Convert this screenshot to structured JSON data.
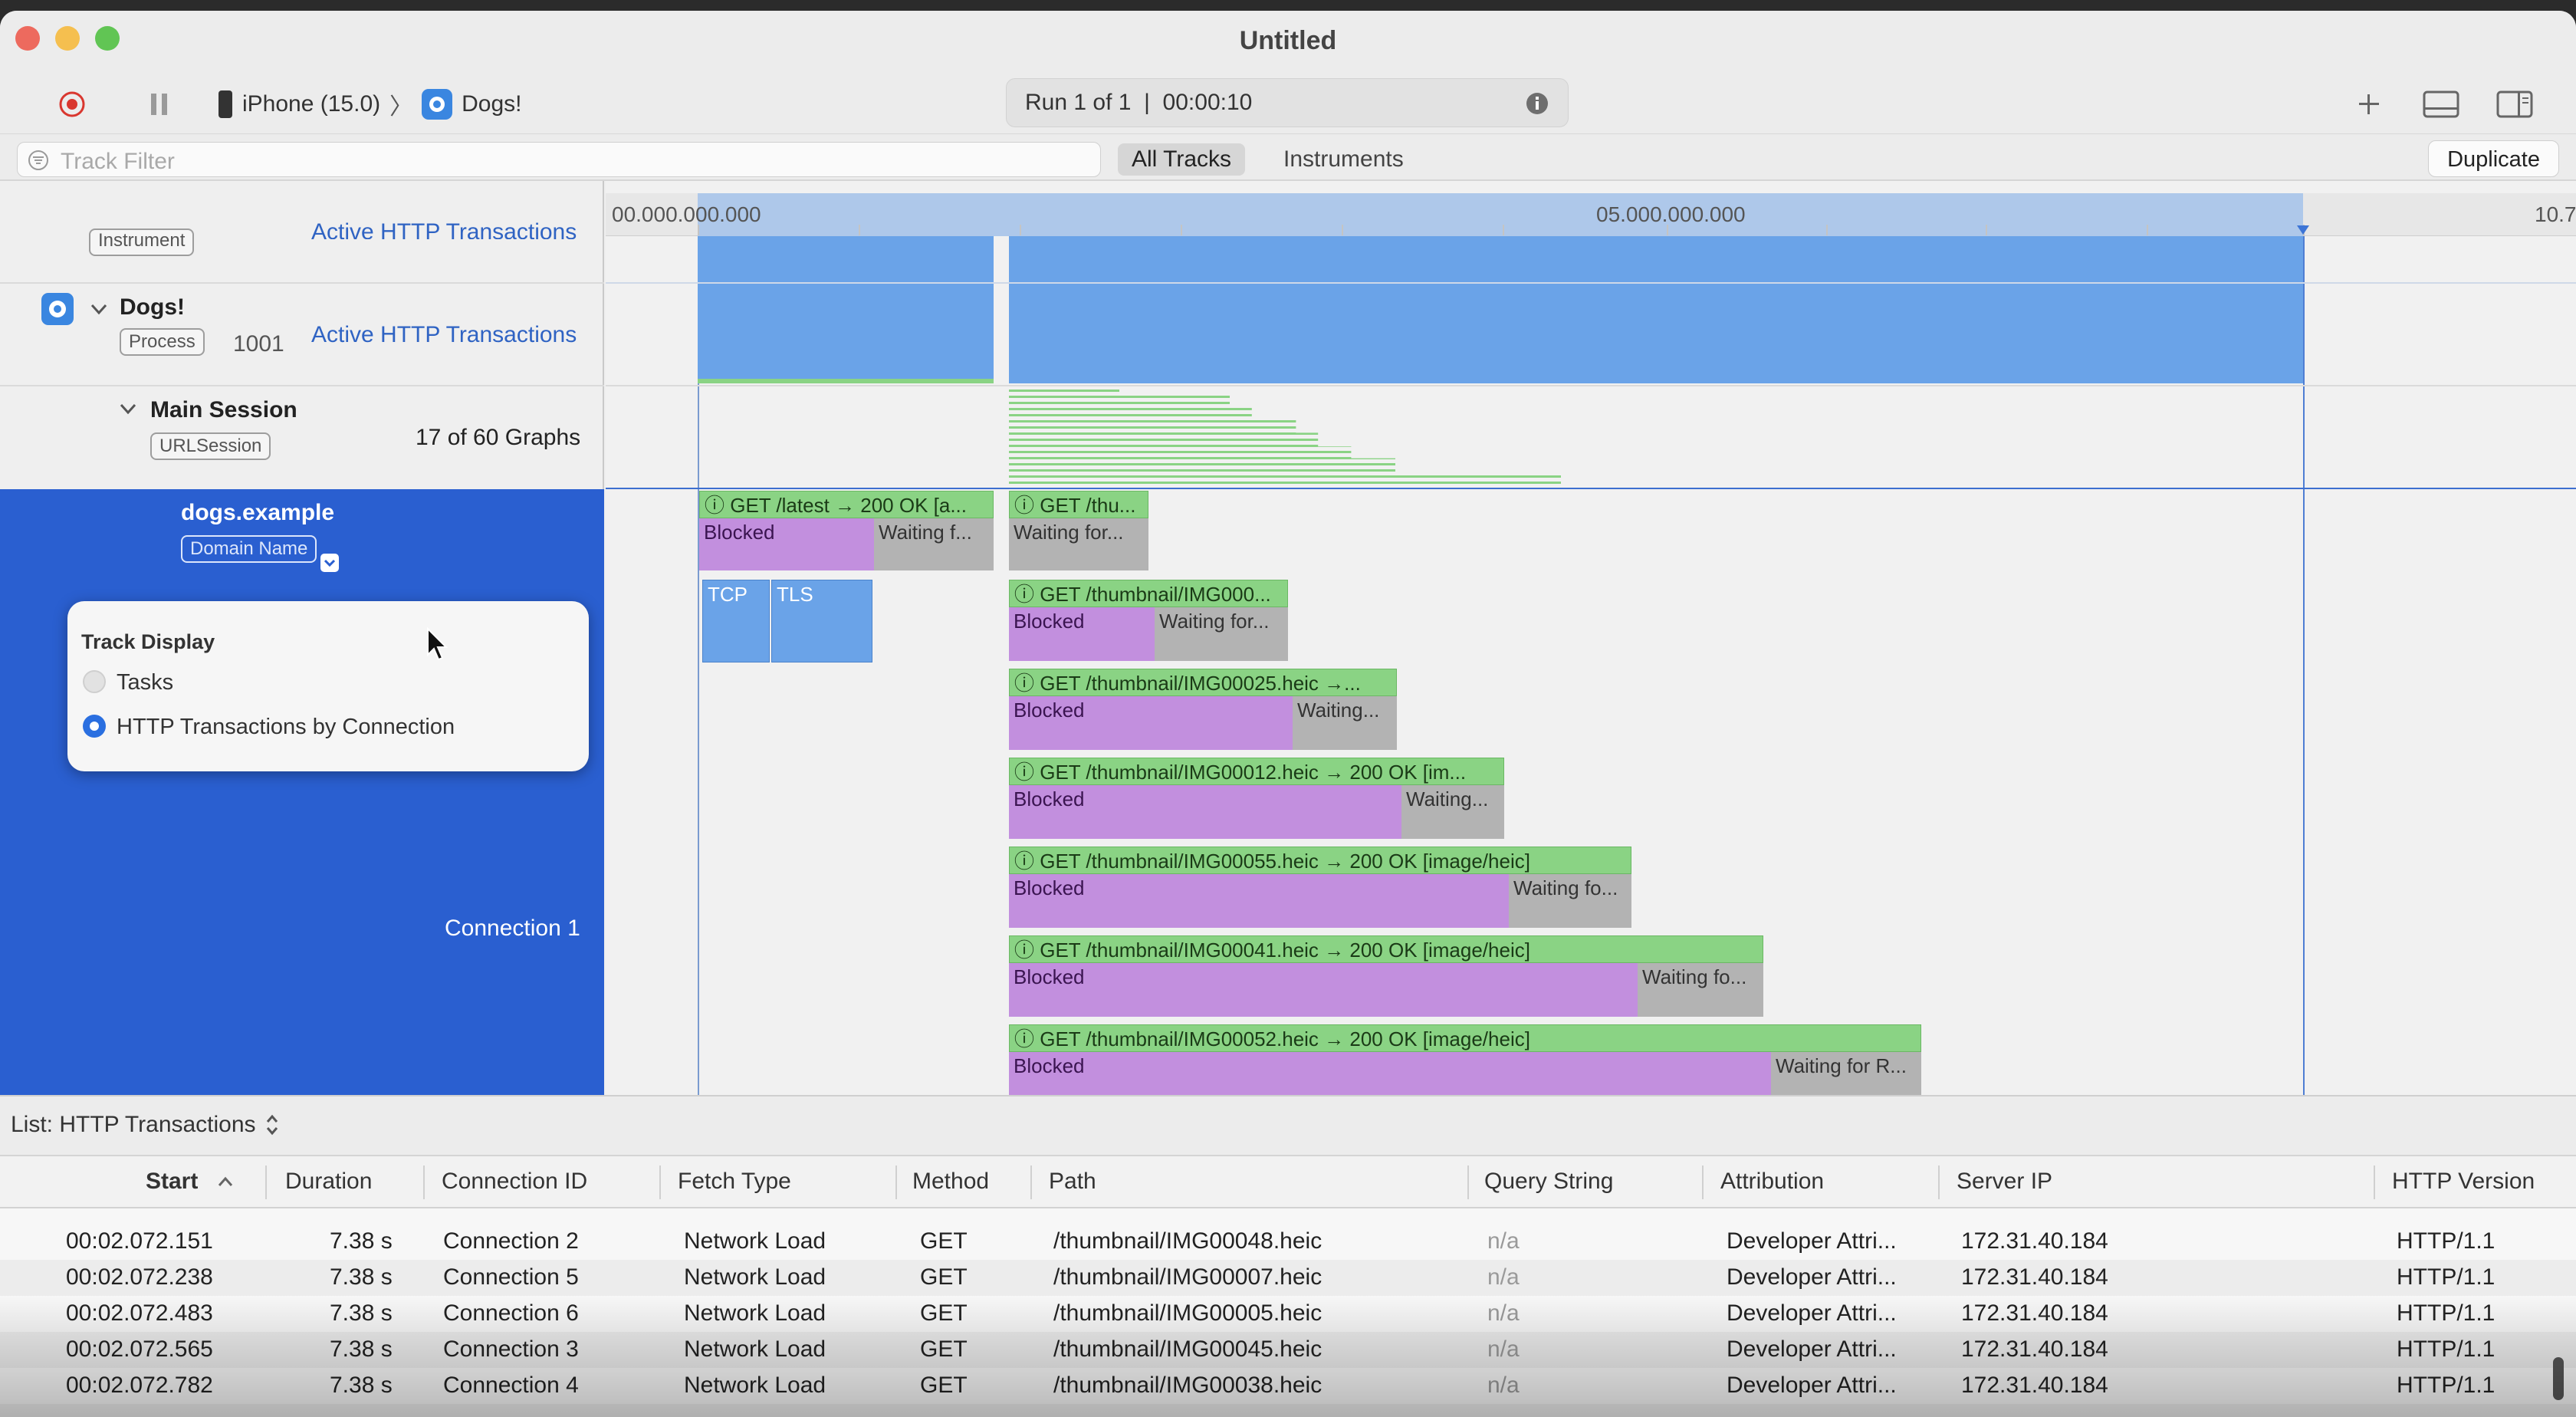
{
  "window": {
    "title": "Untitled"
  },
  "toolbar": {
    "device": "iPhone (15.0)",
    "separator": "〉",
    "target": "Dogs!",
    "run": "Run 1 of 1  |  00:00:10"
  },
  "filter": {
    "placeholder": "Track Filter",
    "seg_all": "All Tracks",
    "seg_instruments": "Instruments",
    "duplicate": "Duplicate"
  },
  "ruler": {
    "t0": "00.000.000.000",
    "t5": "05.000.000.000",
    "t10": "10.7"
  },
  "tracks": {
    "instrument_badge": "Instrument",
    "instrument_label": "Active HTTP Transactions",
    "dogs_name": "Dogs!",
    "dogs_badge": "Process",
    "dogs_pid": "1001",
    "dogs_label": "Active HTTP Transactions",
    "session_name": "Main Session",
    "session_badge": "URLSession",
    "session_graphs": "17 of 60 Graphs",
    "domain_name": "dogs.example",
    "domain_badge": "Domain Name",
    "connection": "Connection 1"
  },
  "popup": {
    "title": "Track Display",
    "opt_tasks": "Tasks",
    "opt_http": "HTTP Transactions by Connection",
    "selected": "HTTP Transactions by Connection"
  },
  "bars": {
    "r0": {
      "get": "ⓘ GET /latest → 200 OK [a...",
      "blocked": "Blocked",
      "waiting": "Waiting f..."
    },
    "r0b": {
      "get": "ⓘ GET /thu...",
      "waiting": "Waiting for..."
    },
    "tcp": "TCP",
    "tls": "TLS",
    "r1": {
      "get": "ⓘ GET /thumbnail/IMG000...",
      "blocked": "Blocked",
      "waiting": "Waiting for..."
    },
    "r2": {
      "get": "ⓘ GET /thumbnail/IMG00025.heic →...",
      "blocked": "Blocked",
      "waiting": "Waiting..."
    },
    "r3": {
      "get": "ⓘ GET /thumbnail/IMG00012.heic → 200 OK [im...",
      "blocked": "Blocked",
      "waiting": "Waiting..."
    },
    "r4": {
      "get": "ⓘ GET /thumbnail/IMG00055.heic → 200 OK [image/heic]",
      "blocked": "Blocked",
      "waiting": "Waiting fo..."
    },
    "r5": {
      "get": "ⓘ GET /thumbnail/IMG00041.heic → 200 OK [image/heic]",
      "blocked": "Blocked",
      "waiting": "Waiting fo..."
    },
    "r6": {
      "get": "ⓘ GET /thumbnail/IMG00052.heic → 200 OK [image/heic]",
      "blocked": "Blocked",
      "waiting": "Waiting for R..."
    }
  },
  "list": {
    "selector": "List: HTTP Transactions",
    "columns": {
      "start": "Start",
      "duration": "Duration",
      "conn": "Connection ID",
      "fetch": "Fetch Type",
      "method": "Method",
      "path": "Path",
      "query": "Query String",
      "attr": "Attribution",
      "ip": "Server IP",
      "http": "HTTP Version"
    },
    "rows": [
      {
        "start": "00:02.072.151",
        "duration": "7.38 s",
        "conn": "Connection 2",
        "fetch": "Network Load",
        "method": "GET",
        "path": "/thumbnail/IMG00048.heic",
        "query": "n/a",
        "attr": "Developer Attri...",
        "ip": "172.31.40.184",
        "http": "HTTP/1.1"
      },
      {
        "start": "00:02.072.238",
        "duration": "7.38 s",
        "conn": "Connection 5",
        "fetch": "Network Load",
        "method": "GET",
        "path": "/thumbnail/IMG00007.heic",
        "query": "n/a",
        "attr": "Developer Attri...",
        "ip": "172.31.40.184",
        "http": "HTTP/1.1"
      },
      {
        "start": "00:02.072.483",
        "duration": "7.38 s",
        "conn": "Connection 6",
        "fetch": "Network Load",
        "method": "GET",
        "path": "/thumbnail/IMG00005.heic",
        "query": "n/a",
        "attr": "Developer Attri...",
        "ip": "172.31.40.184",
        "http": "HTTP/1.1"
      },
      {
        "start": "00:02.072.565",
        "duration": "7.38 s",
        "conn": "Connection 3",
        "fetch": "Network Load",
        "method": "GET",
        "path": "/thumbnail/IMG00045.heic",
        "query": "n/a",
        "attr": "Developer Attri...",
        "ip": "172.31.40.184",
        "http": "HTTP/1.1"
      },
      {
        "start": "00:02.072.782",
        "duration": "7.38 s",
        "conn": "Connection 4",
        "fetch": "Network Load",
        "method": "GET",
        "path": "/thumbnail/IMG00038.heic",
        "query": "n/a",
        "attr": "Developer Attri...",
        "ip": "172.31.40.184",
        "http": "HTTP/1.1"
      }
    ]
  },
  "colors": {
    "accent": "#2a5fd0",
    "green": "#8ad384",
    "purple": "#c28fde",
    "blue": "#6aa3e8",
    "gray": "#b3b3b3"
  }
}
